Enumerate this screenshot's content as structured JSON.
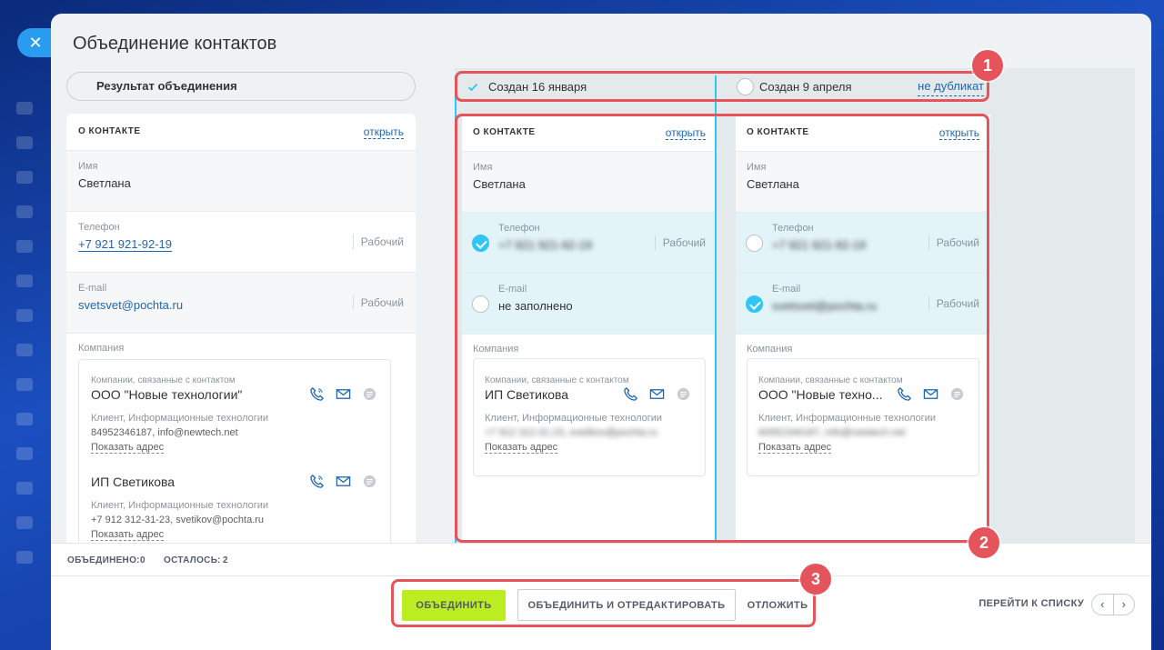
{
  "panel": {
    "title": "Объединение контактов",
    "close_glyph": "✕"
  },
  "result": {
    "tab_label": "Результат объединения",
    "section_title": "О КОНТАКТЕ",
    "open_label": "открыть",
    "name_label": "Имя",
    "name_value": "Светлана",
    "phone_label": "Телефон",
    "phone_value": "+7 921 921-92-19",
    "phone_type": "Рабочий",
    "email_label": "E-mail",
    "email_value": "svetsvet@pochta.ru",
    "email_type": "Рабочий",
    "company_label": "Компания",
    "companies": [
      {
        "caption": "Компании, связанные с контактом",
        "name": "ООО \"Новые технологии\"",
        "desc": "Клиент, Информационные технологии",
        "contacts": "84952346187, info@newtech.net",
        "address": "Показать адрес"
      },
      {
        "caption": "",
        "name": "ИП Светикова",
        "desc": "Клиент, Информационные технологии",
        "contacts": "+7 912 312-31-23, svetikov@pochta.ru",
        "address": "Показать адрес"
      }
    ]
  },
  "duplicates": [
    {
      "tab_label": "Создан 16 января",
      "section_title": "О КОНТАКТЕ",
      "open_label": "открыть",
      "name_label": "Имя",
      "name_value": "Светлана",
      "phone_label": "Телефон",
      "phone_value": "+7 921 921-92-19",
      "phone_type": "Рабочий",
      "email_label": "E-mail",
      "email_value": "не заполнено",
      "email_type": "",
      "company_label": "Компания",
      "company_caption": "Компании, связанные с контактом",
      "company_name": "ИП Светикова",
      "company_desc": "Клиент, Информационные технологии",
      "company_contacts": "+7 912 312-31-23, svetikov@pochta.ru",
      "company_address": "Показать адрес"
    },
    {
      "tab_label": "Создан 9 апреля",
      "not_duplicate_label": "не дубликат",
      "section_title": "О КОНТАКТЕ",
      "open_label": "открыть",
      "name_label": "Имя",
      "name_value": "Светлана",
      "phone_label": "Телефон",
      "phone_value": "+7 921 921-92-19",
      "phone_type": "Рабочий",
      "email_label": "E-mail",
      "email_value": "svetsvet@pochta.ru",
      "email_type": "Рабочий",
      "company_label": "Компания",
      "company_caption": "Компании, связанные с контактом",
      "company_name": "ООО \"Новые техно...",
      "company_desc": "Клиент, Информационные технологии",
      "company_contacts": "84952346187, info@newtech.net",
      "company_address": "Показать адрес"
    }
  ],
  "counters": {
    "merged_label": "ОБЪЕДИНЕНО:",
    "merged_value": "0",
    "left_label": "ОСТАЛОСЬ:",
    "left_value": "2"
  },
  "actions": {
    "merge": "ОБЪЕДИНИТЬ",
    "merge_edit": "ОБЪЕДИНИТЬ И ОТРЕДАКТИРОВАТЬ",
    "postpone": "ОТЛОЖИТЬ",
    "go_to_list": "ПЕРЕЙТИ К СПИСКУ",
    "prev": "‹",
    "next": "›"
  },
  "badges": [
    "1",
    "2",
    "3"
  ],
  "colors": {
    "accent_blue": "#2fc6f6",
    "highlight_red": "#e5545b",
    "merge_green": "#bbed21",
    "link_blue": "#2067b0"
  }
}
